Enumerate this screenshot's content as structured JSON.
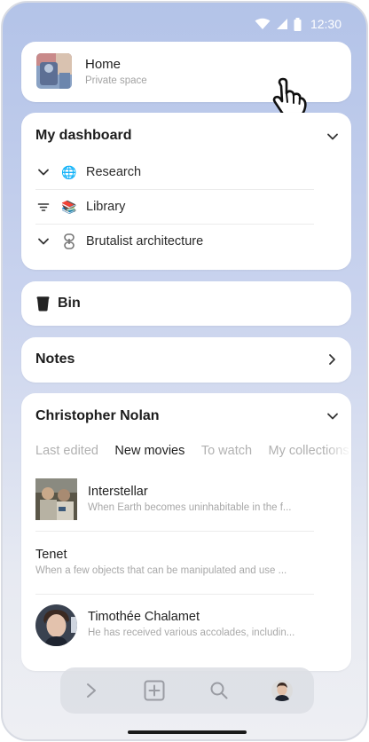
{
  "status_bar": {
    "time": "12:30"
  },
  "home_card": {
    "title": "Home",
    "subtitle": "Private space"
  },
  "dashboard": {
    "title": "My dashboard",
    "items": [
      {
        "label": "Research",
        "leading_icon": "chevron-down-icon",
        "emoji": "🌐"
      },
      {
        "label": "Library",
        "leading_icon": "filter-icon",
        "emoji": "📚"
      },
      {
        "label": "Brutalist architecture",
        "leading_icon": "chevron-down-icon",
        "emoji": "⛓"
      }
    ]
  },
  "bin": {
    "label": "Bin"
  },
  "notes": {
    "label": "Notes"
  },
  "nolan": {
    "title": "Christopher Nolan",
    "tabs": [
      "Last edited",
      "New movies",
      "To watch",
      "My collections"
    ],
    "active_tab": "New movies",
    "items": [
      {
        "title": "Interstellar",
        "description": "When Earth becomes uninhabitable in the f..."
      },
      {
        "title": "Tenet",
        "description": "When a few objects that can be manipulated and use ..."
      },
      {
        "title": "Timothée Chalamet",
        "description": "He has received various accolades, includin..."
      }
    ]
  },
  "bottom_nav": {
    "items": [
      "chevron-right-icon",
      "add-square-icon",
      "search-icon",
      "profile-avatar"
    ]
  },
  "colors": {
    "background_top": "#b3c3e8",
    "background_bottom": "#eeeff3",
    "card": "#ffffff",
    "muted_text": "#a8a8a8"
  }
}
